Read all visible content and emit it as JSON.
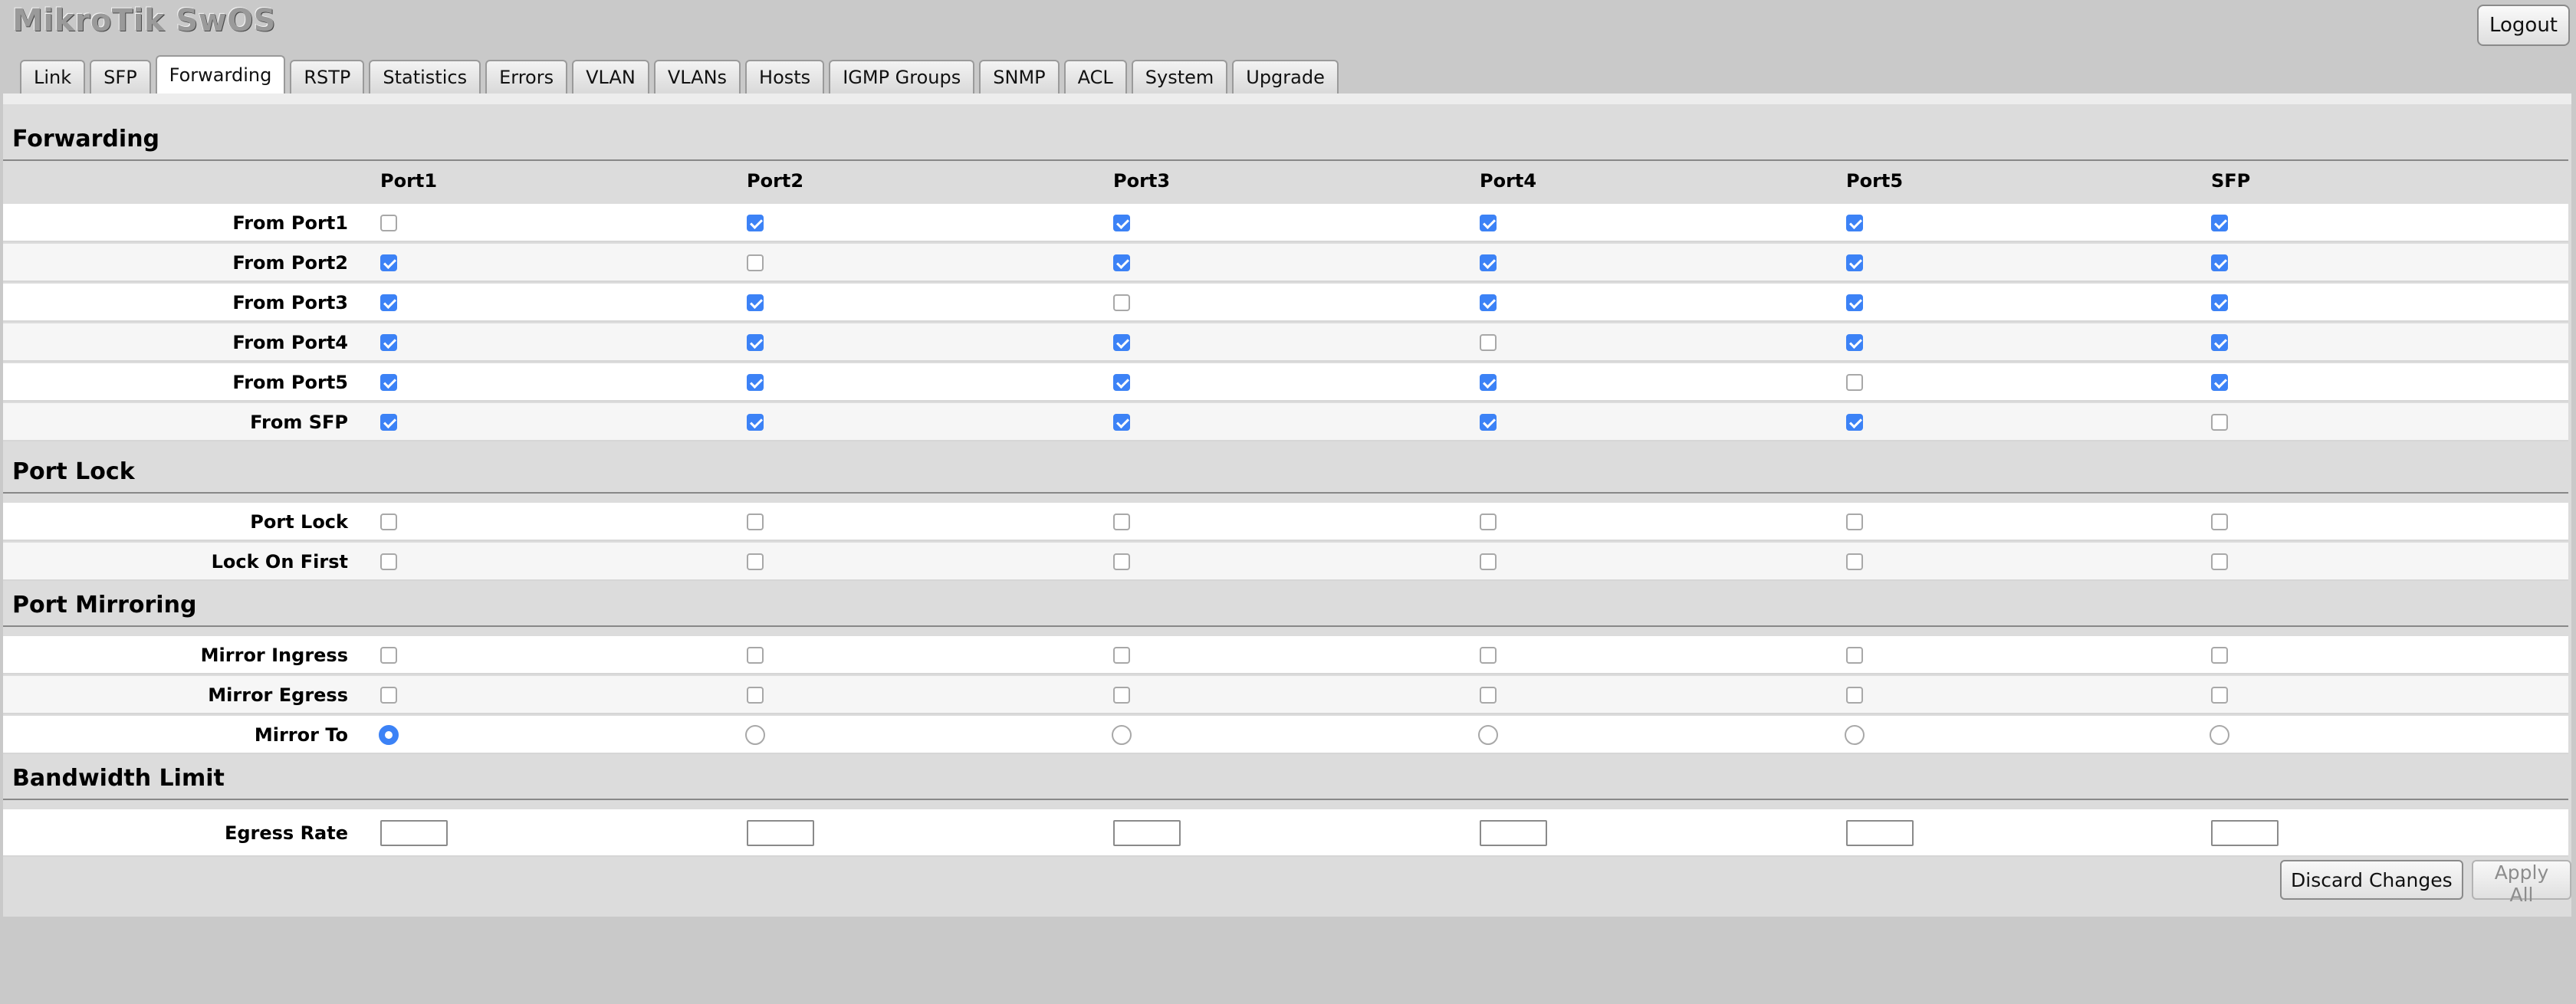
{
  "app": {
    "title": "MikroTik SwOS",
    "logout_label": "Logout"
  },
  "tabs": [
    {
      "label": "Link"
    },
    {
      "label": "SFP"
    },
    {
      "label": "Forwarding",
      "active": true
    },
    {
      "label": "RSTP"
    },
    {
      "label": "Statistics"
    },
    {
      "label": "Errors"
    },
    {
      "label": "VLAN"
    },
    {
      "label": "VLANs"
    },
    {
      "label": "Hosts"
    },
    {
      "label": "IGMP Groups"
    },
    {
      "label": "SNMP"
    },
    {
      "label": "ACL"
    },
    {
      "label": "System"
    },
    {
      "label": "Upgrade"
    }
  ],
  "columns": [
    "Port1",
    "Port2",
    "Port3",
    "Port4",
    "Port5",
    "SFP"
  ],
  "forwarding": {
    "title": "Forwarding",
    "rows": [
      {
        "label": "From Port1",
        "values": [
          false,
          true,
          true,
          true,
          true,
          true
        ]
      },
      {
        "label": "From Port2",
        "values": [
          true,
          false,
          true,
          true,
          true,
          true
        ]
      },
      {
        "label": "From Port3",
        "values": [
          true,
          true,
          false,
          true,
          true,
          true
        ]
      },
      {
        "label": "From Port4",
        "values": [
          true,
          true,
          true,
          false,
          true,
          true
        ]
      },
      {
        "label": "From Port5",
        "values": [
          true,
          true,
          true,
          true,
          false,
          true
        ]
      },
      {
        "label": "From SFP",
        "values": [
          true,
          true,
          true,
          true,
          true,
          false
        ]
      }
    ]
  },
  "port_lock": {
    "title": "Port Lock",
    "rows": [
      {
        "label": "Port Lock",
        "values": [
          false,
          false,
          false,
          false,
          false,
          false
        ]
      },
      {
        "label": "Lock On First",
        "values": [
          false,
          false,
          false,
          false,
          false,
          false
        ]
      }
    ]
  },
  "port_mirroring": {
    "title": "Port Mirroring",
    "rows": [
      {
        "label": "Mirror Ingress",
        "values": [
          false,
          false,
          false,
          false,
          false,
          false
        ]
      },
      {
        "label": "Mirror Egress",
        "values": [
          false,
          false,
          false,
          false,
          false,
          false
        ]
      }
    ],
    "mirror_to": {
      "label": "Mirror To",
      "selected_index": 0
    }
  },
  "bandwidth_limit": {
    "title": "Bandwidth Limit",
    "egress": {
      "label": "Egress Rate",
      "values": [
        "",
        "",
        "",
        "",
        "",
        ""
      ]
    }
  },
  "actions": {
    "discard_label": "Discard Changes",
    "apply_label": "Apply All"
  }
}
